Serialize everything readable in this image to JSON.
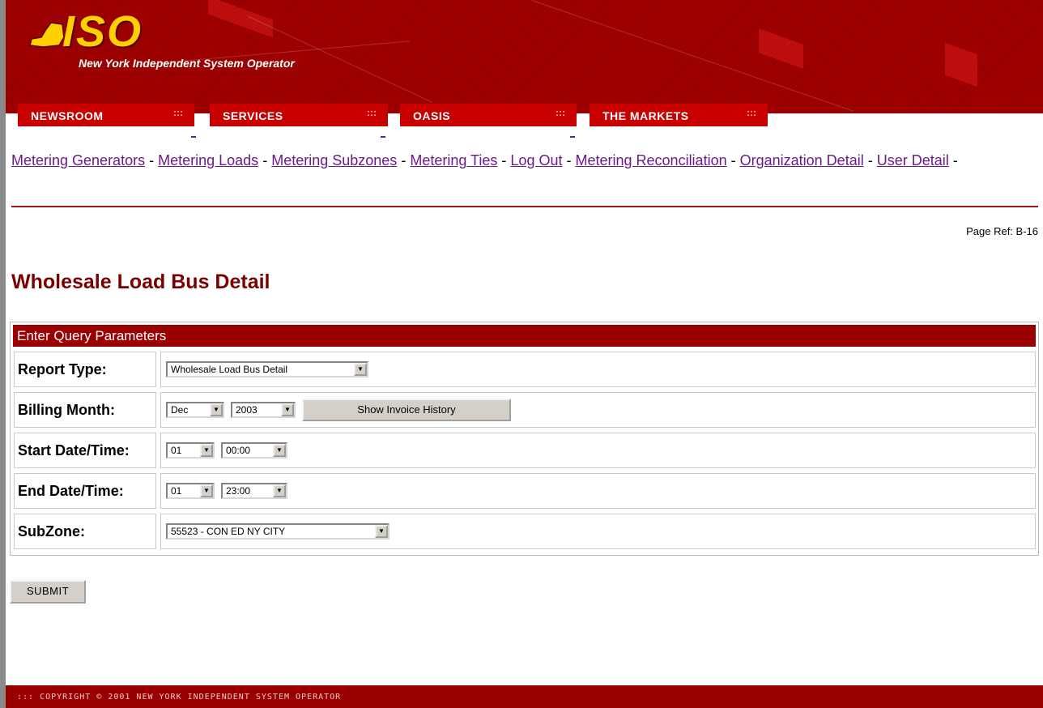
{
  "header": {
    "logo_text": "ISO",
    "org_name": "New York Independent System Operator"
  },
  "nav": {
    "tabs": [
      {
        "label": "NEWSROOM"
      },
      {
        "label": "SERVICES"
      },
      {
        "label": "OASIS"
      },
      {
        "label": "THE MARKETS"
      }
    ],
    "tab_dots": ":::"
  },
  "links": {
    "items": [
      "Metering Generators",
      "Metering Loads",
      "Metering Subzones",
      "Metering Ties",
      "Log Out",
      "Metering Reconciliation",
      "Organization Detail",
      "User Detail"
    ],
    "separator": "-"
  },
  "page": {
    "ref": "Page Ref: B-16",
    "title": "Wholesale Load Bus Detail"
  },
  "query": {
    "heading": "Enter Query Parameters",
    "report_type": {
      "label": "Report Type:",
      "value": "Wholesale Load Bus Detail"
    },
    "billing_month": {
      "label": "Billing Month:",
      "month": "Dec",
      "year": "2003",
      "history_button": "Show Invoice History"
    },
    "start": {
      "label": "Start Date/Time:",
      "day": "01",
      "time": "00:00"
    },
    "end": {
      "label": "End Date/Time:",
      "day": "01",
      "time": "23:00"
    },
    "subzone": {
      "label": "SubZone:",
      "value": "55523 - CON ED NY CITY"
    }
  },
  "actions": {
    "submit": "SUBMIT"
  },
  "footer": {
    "text": "::: COPYRIGHT © 2001 NEW YORK INDEPENDENT SYSTEM OPERATOR"
  },
  "colors": {
    "brand_red": "#9a0000",
    "tab_red": "#c80000",
    "logo_yellow": "#ffd000",
    "link_purple": "#6a1a8a"
  },
  "icons": {
    "select_arrow": "chevron-down-icon",
    "logo": "new-york-state-map-icon"
  }
}
